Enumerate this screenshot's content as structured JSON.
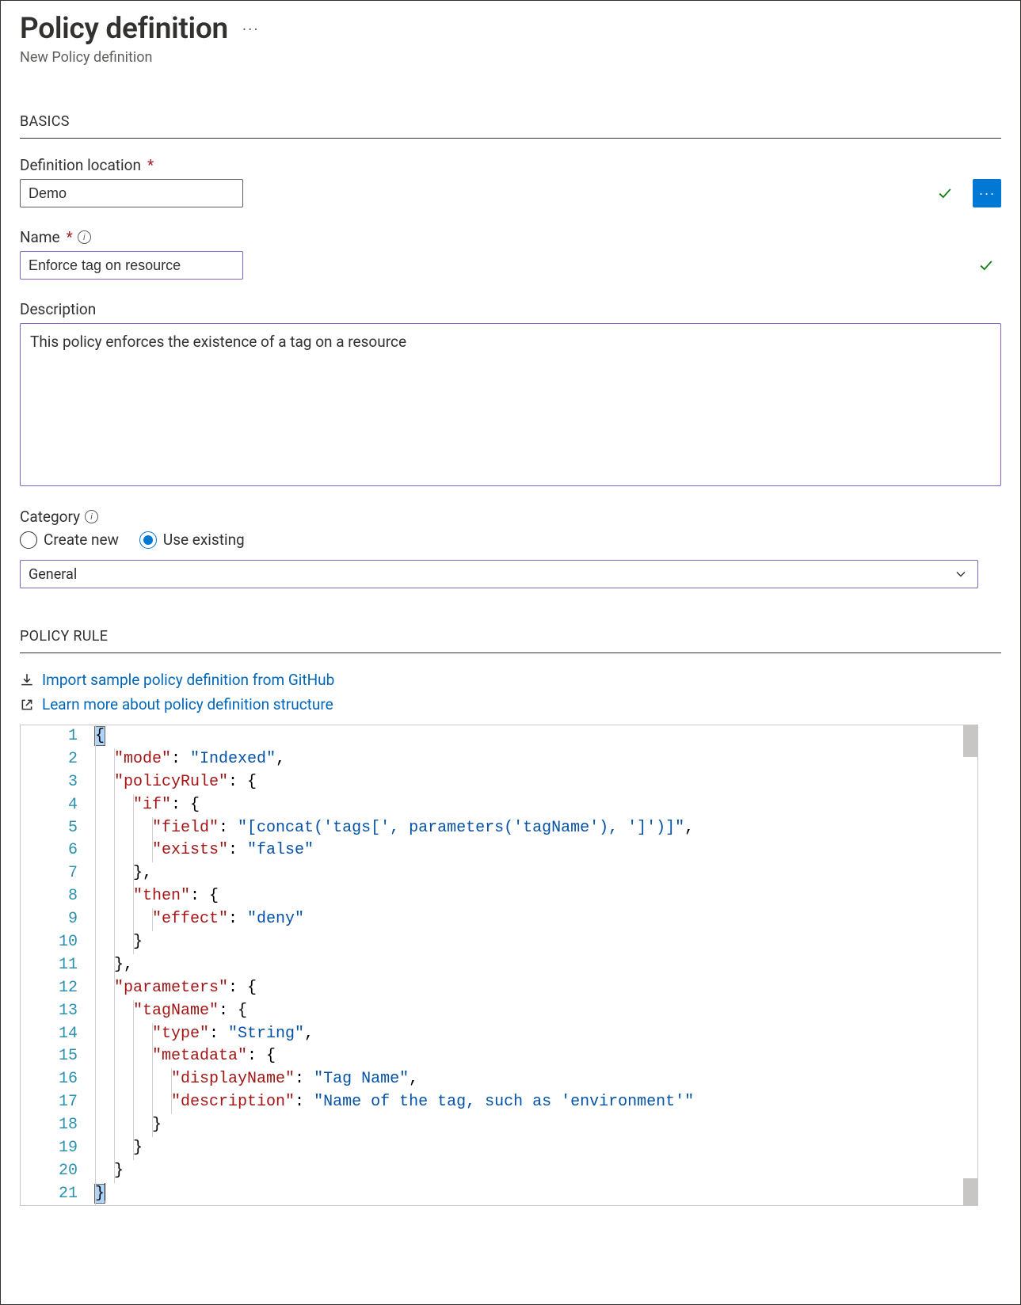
{
  "header": {
    "title": "Policy definition",
    "subtitle": "New Policy definition"
  },
  "sections": {
    "basics": "BASICS",
    "policyRule": "POLICY RULE"
  },
  "basics": {
    "definitionLocationLabel": "Definition location",
    "definitionLocationValue": "Demo",
    "nameLabel": "Name",
    "nameValue": "Enforce tag on resource",
    "descriptionLabel": "Description",
    "descriptionValue": "This policy enforces the existence of a tag on a resource",
    "categoryLabel": "Category",
    "categoryOptions": {
      "createNew": "Create new",
      "useExisting": "Use existing"
    },
    "categorySelected": "useExisting",
    "categoryDropdownValue": "General"
  },
  "policyRule": {
    "importLink": "Import sample policy definition from GitHub",
    "learnLink": "Learn more about policy definition structure"
  },
  "editor": {
    "lineCount": 21,
    "lines": [
      {
        "indent": 0,
        "tokens": [
          {
            "t": "punc",
            "v": "{"
          }
        ]
      },
      {
        "indent": 1,
        "tokens": [
          {
            "t": "key",
            "v": "\"mode\""
          },
          {
            "t": "punc",
            "v": ": "
          },
          {
            "t": "str",
            "v": "\"Indexed\""
          },
          {
            "t": "punc",
            "v": ","
          }
        ]
      },
      {
        "indent": 1,
        "tokens": [
          {
            "t": "key",
            "v": "\"policyRule\""
          },
          {
            "t": "punc",
            "v": ": {"
          }
        ]
      },
      {
        "indent": 2,
        "tokens": [
          {
            "t": "key",
            "v": "\"if\""
          },
          {
            "t": "punc",
            "v": ": {"
          }
        ]
      },
      {
        "indent": 3,
        "tokens": [
          {
            "t": "key",
            "v": "\"field\""
          },
          {
            "t": "punc",
            "v": ": "
          },
          {
            "t": "str",
            "v": "\"[concat('tags[', parameters('tagName'), ']')]\""
          },
          {
            "t": "punc",
            "v": ","
          }
        ]
      },
      {
        "indent": 3,
        "tokens": [
          {
            "t": "key",
            "v": "\"exists\""
          },
          {
            "t": "punc",
            "v": ": "
          },
          {
            "t": "str",
            "v": "\"false\""
          }
        ]
      },
      {
        "indent": 2,
        "tokens": [
          {
            "t": "punc",
            "v": "},"
          }
        ]
      },
      {
        "indent": 2,
        "tokens": [
          {
            "t": "key",
            "v": "\"then\""
          },
          {
            "t": "punc",
            "v": ": {"
          }
        ]
      },
      {
        "indent": 3,
        "tokens": [
          {
            "t": "key",
            "v": "\"effect\""
          },
          {
            "t": "punc",
            "v": ": "
          },
          {
            "t": "str",
            "v": "\"deny\""
          }
        ]
      },
      {
        "indent": 2,
        "tokens": [
          {
            "t": "punc",
            "v": "}"
          }
        ]
      },
      {
        "indent": 1,
        "tokens": [
          {
            "t": "punc",
            "v": "},"
          }
        ]
      },
      {
        "indent": 1,
        "tokens": [
          {
            "t": "key",
            "v": "\"parameters\""
          },
          {
            "t": "punc",
            "v": ": {"
          }
        ]
      },
      {
        "indent": 2,
        "tokens": [
          {
            "t": "key",
            "v": "\"tagName\""
          },
          {
            "t": "punc",
            "v": ": {"
          }
        ]
      },
      {
        "indent": 3,
        "tokens": [
          {
            "t": "key",
            "v": "\"type\""
          },
          {
            "t": "punc",
            "v": ": "
          },
          {
            "t": "str",
            "v": "\"String\""
          },
          {
            "t": "punc",
            "v": ","
          }
        ]
      },
      {
        "indent": 3,
        "tokens": [
          {
            "t": "key",
            "v": "\"metadata\""
          },
          {
            "t": "punc",
            "v": ": {"
          }
        ]
      },
      {
        "indent": 4,
        "tokens": [
          {
            "t": "key",
            "v": "\"displayName\""
          },
          {
            "t": "punc",
            "v": ": "
          },
          {
            "t": "str",
            "v": "\"Tag Name\""
          },
          {
            "t": "punc",
            "v": ","
          }
        ]
      },
      {
        "indent": 4,
        "tokens": [
          {
            "t": "key",
            "v": "\"description\""
          },
          {
            "t": "punc",
            "v": ": "
          },
          {
            "t": "str",
            "v": "\"Name of the tag, such as 'environment'\""
          }
        ]
      },
      {
        "indent": 3,
        "tokens": [
          {
            "t": "punc",
            "v": "}"
          }
        ]
      },
      {
        "indent": 2,
        "tokens": [
          {
            "t": "punc",
            "v": "}"
          }
        ]
      },
      {
        "indent": 1,
        "tokens": [
          {
            "t": "punc",
            "v": "}"
          }
        ]
      },
      {
        "indent": 0,
        "tokens": [
          {
            "t": "punc",
            "v": "}"
          }
        ],
        "cursorAfter": true,
        "selectedOpen": true
      }
    ]
  }
}
